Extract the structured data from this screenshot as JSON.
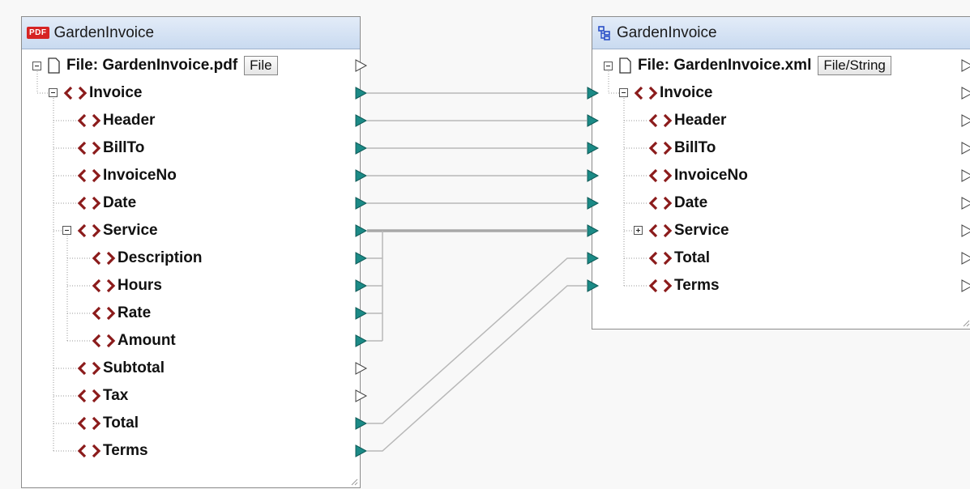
{
  "source": {
    "icon": "pdf-icon",
    "icon_text": "PDF",
    "title": "GardenInvoice",
    "file_label": "File: GardenInvoice.pdf",
    "file_button": "File",
    "items": [
      {
        "label": "Invoice"
      },
      {
        "label": "Header"
      },
      {
        "label": "BillTo"
      },
      {
        "label": "InvoiceNo"
      },
      {
        "label": "Date"
      },
      {
        "label": "Service"
      },
      {
        "label": "Description"
      },
      {
        "label": "Hours"
      },
      {
        "label": "Rate"
      },
      {
        "label": "Amount"
      },
      {
        "label": "Subtotal"
      },
      {
        "label": "Tax"
      },
      {
        "label": "Total"
      },
      {
        "label": "Terms"
      }
    ]
  },
  "target": {
    "icon": "xml-structure-icon",
    "title": "GardenInvoice",
    "file_label": "File: GardenInvoice.xml",
    "file_button": "File/String",
    "items": [
      {
        "label": "Invoice"
      },
      {
        "label": "Header"
      },
      {
        "label": "BillTo"
      },
      {
        "label": "InvoiceNo"
      },
      {
        "label": "Date"
      },
      {
        "label": "Service"
      },
      {
        "label": "Total"
      },
      {
        "label": "Terms"
      }
    ]
  },
  "colors": {
    "connected": "#1b8a86",
    "tag": "#8b1b1b",
    "line": "#b8b8b8"
  }
}
